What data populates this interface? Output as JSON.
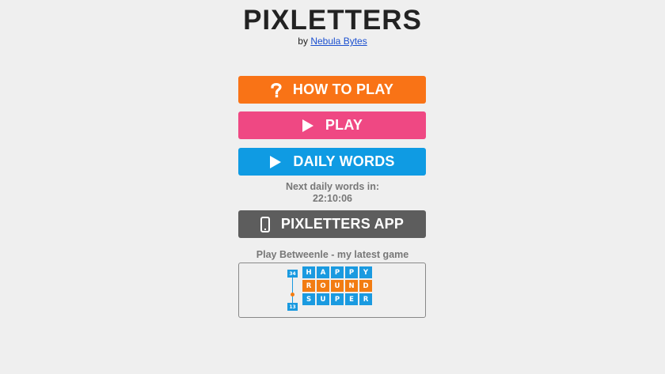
{
  "header": {
    "title": "PIXLETTERS",
    "by_label": "by",
    "author": "Nebula Bytes"
  },
  "menu": {
    "how_to_play": "HOW TO PLAY",
    "play": "PLAY",
    "daily_words": "DAILY WORDS",
    "app": "PIXLETTERS APP"
  },
  "daily": {
    "next_label": "Next daily words in:",
    "countdown": "22:10:06"
  },
  "promo": {
    "label": "Play Betweenle - my latest game",
    "top_number": "34",
    "bottom_number": "13",
    "words": [
      {
        "letters": [
          "H",
          "A",
          "P",
          "P",
          "Y"
        ],
        "color": "#1a9ae0"
      },
      {
        "letters": [
          "R",
          "O",
          "U",
          "N",
          "D"
        ],
        "color": "#f27c12"
      },
      {
        "letters": [
          "S",
          "U",
          "P",
          "E",
          "R"
        ],
        "color": "#1a9ae0"
      }
    ]
  },
  "colors": {
    "how_to_play": "#f97316",
    "play": "#ef4883",
    "daily_words": "#0f9be3",
    "app": "#5d5d5d"
  },
  "icons": {
    "how_to_play": "question-icon",
    "play": "play-icon",
    "daily_words": "play-icon",
    "app": "mobile-phone-icon"
  }
}
